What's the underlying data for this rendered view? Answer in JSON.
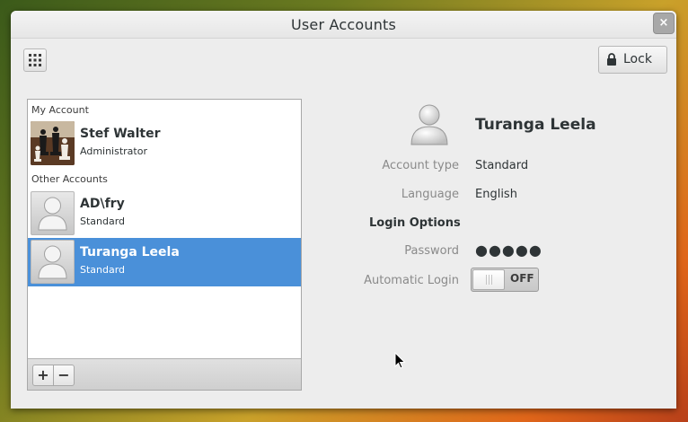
{
  "window": {
    "title": "User Accounts",
    "close_glyph": "×"
  },
  "toolbar": {
    "apps_icon": "app-grid-icon",
    "lock_label": "Lock",
    "lock_icon": "padlock-icon"
  },
  "accounts": {
    "my_account_label": "My Account",
    "other_accounts_label": "Other Accounts",
    "my_account": {
      "name": "Stef Walter",
      "role": "Administrator",
      "avatar": "chess-pieces-photo"
    },
    "others": [
      {
        "name": "AD\\fry",
        "role": "Standard",
        "avatar": "generic-user-icon"
      },
      {
        "name": "Turanga Leela",
        "role": "Standard",
        "avatar": "generic-user-icon",
        "selected": true
      }
    ],
    "add_glyph": "+",
    "remove_glyph": "−"
  },
  "details": {
    "name": "Turanga Leela",
    "account_type_label": "Account type",
    "account_type_value": "Standard",
    "language_label": "Language",
    "language_value": "English",
    "login_options_header": "Login Options",
    "password_label": "Password",
    "password_value": "●●●●●",
    "automatic_login_label": "Automatic Login",
    "automatic_login_state": "OFF"
  },
  "colors": {
    "selection": "#4a90d9",
    "window_bg": "#ededed"
  }
}
